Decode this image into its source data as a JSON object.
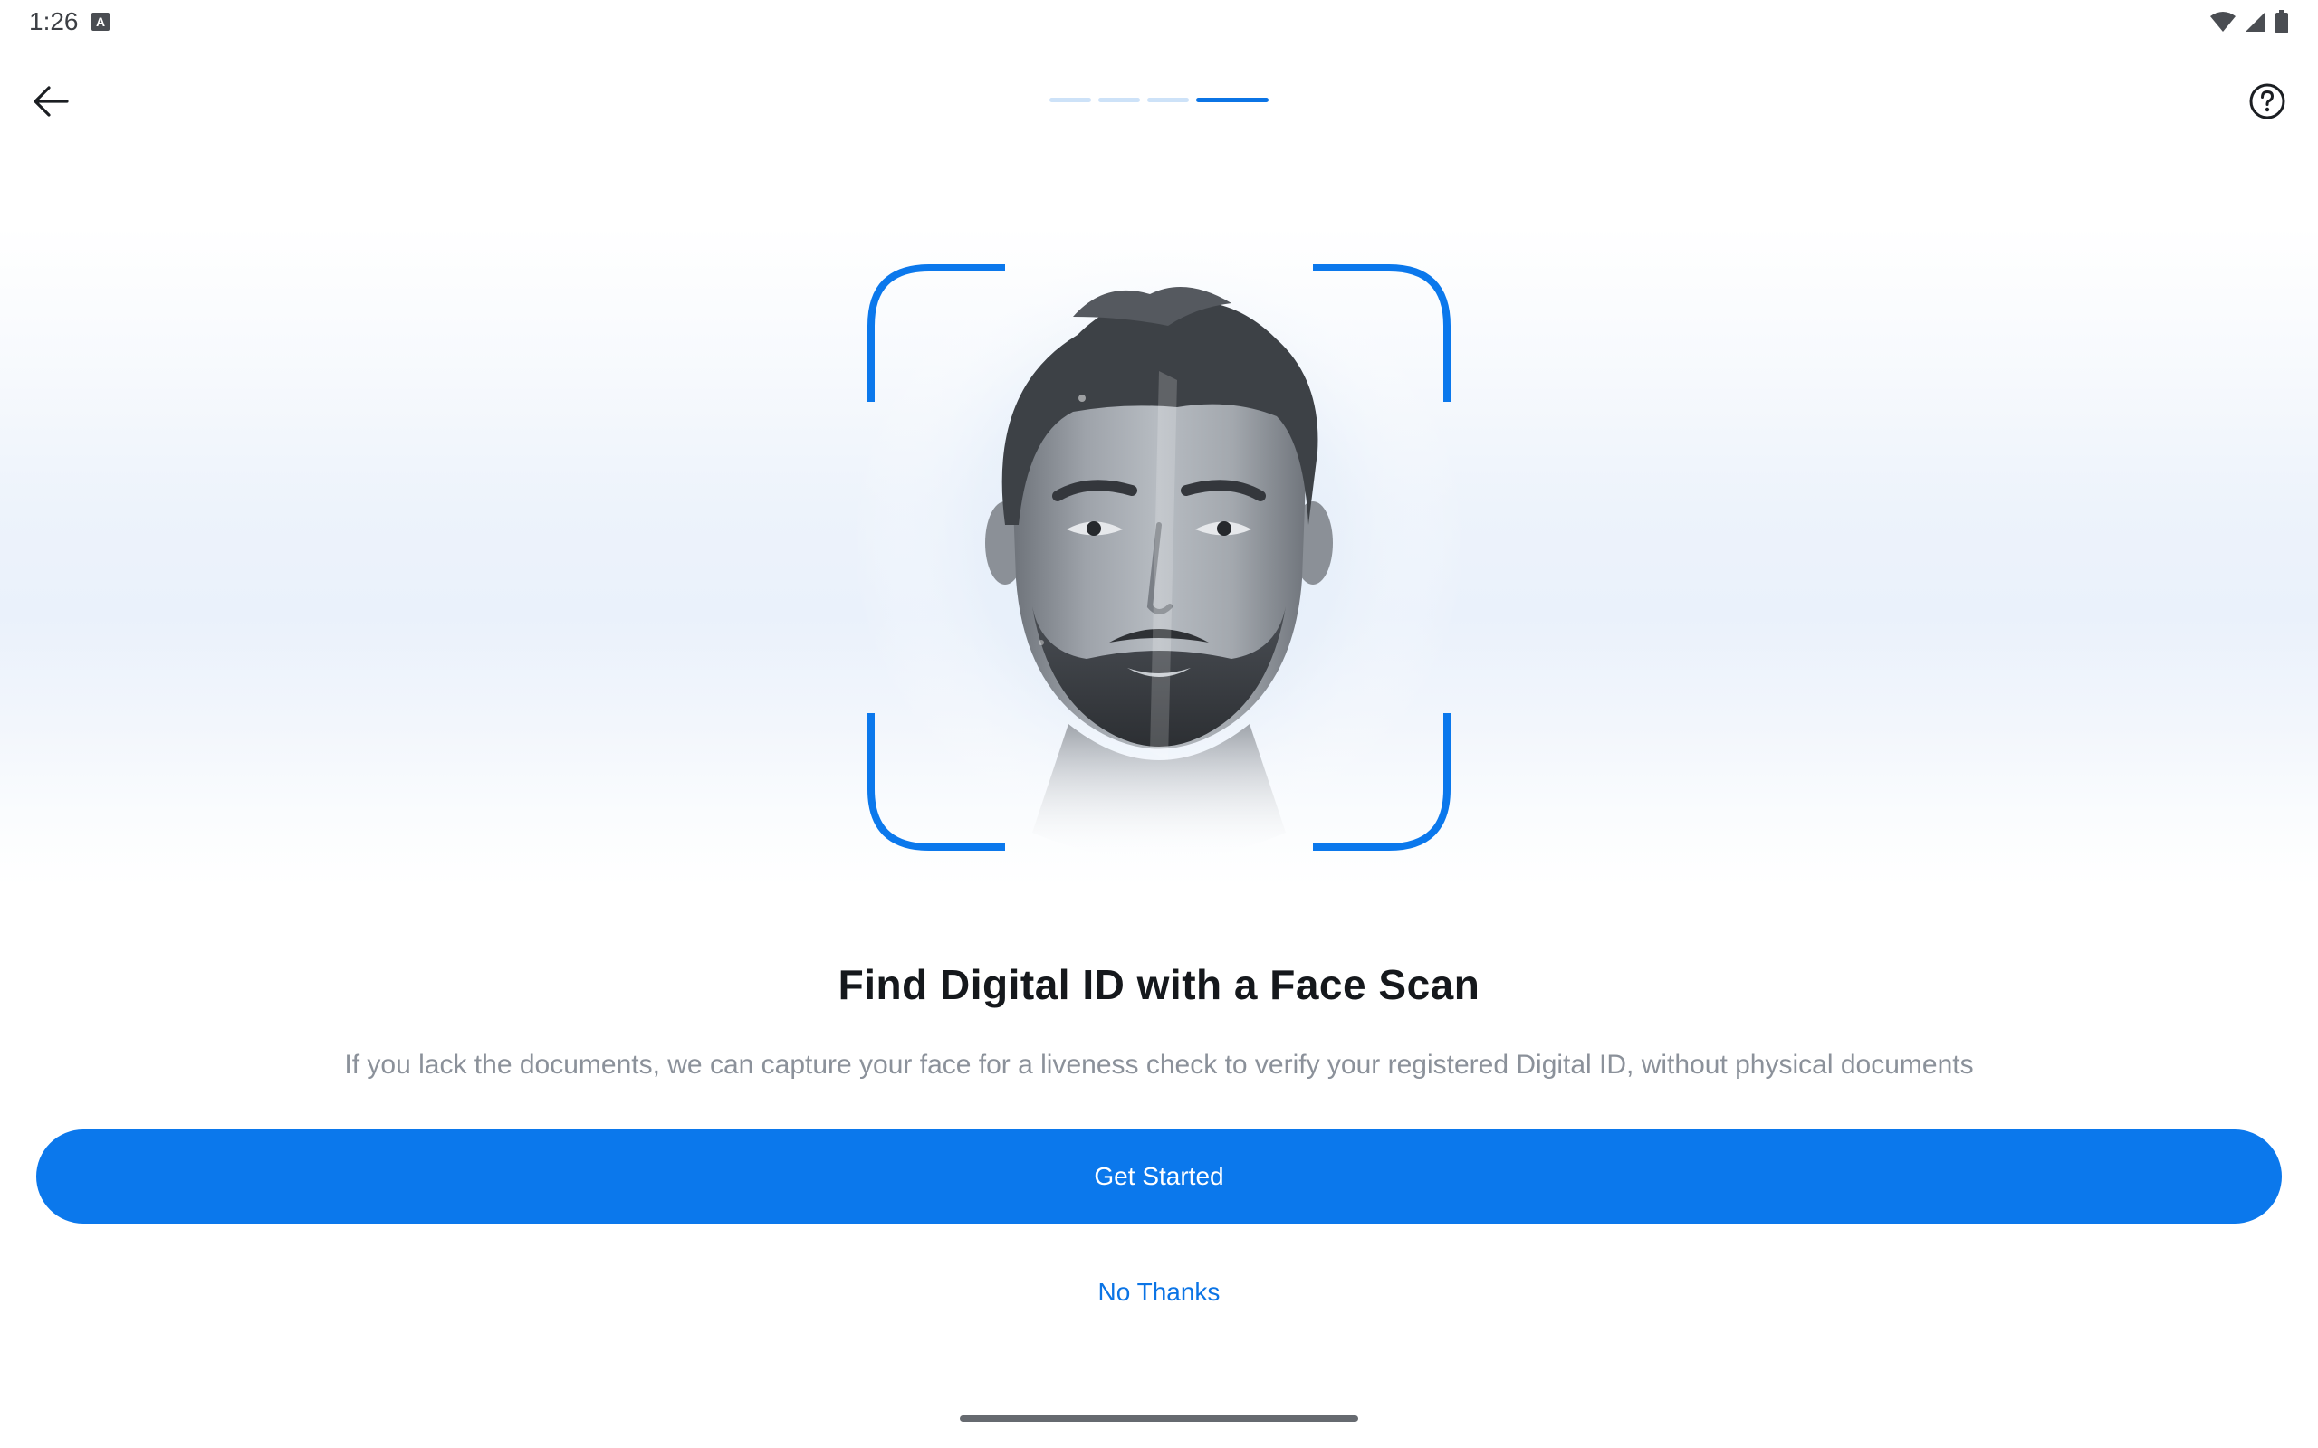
{
  "status_bar": {
    "time": "1:26",
    "notification_icon": "a-badge-icon",
    "icons": [
      "wifi-icon",
      "signal-icon",
      "battery-icon"
    ]
  },
  "app_bar": {
    "back_icon": "arrow-left-icon",
    "help_icon": "help-circle-icon"
  },
  "progress": {
    "total_steps": 4,
    "current_step": 4
  },
  "illustration": {
    "frame_icon": "face-scan-frame-icon",
    "image": "face-portrait"
  },
  "content": {
    "title": "Find Digital ID with a Face Scan",
    "description": "If you lack the documents, we can capture your face for a liveness check to verify your registered Digital ID, without physical documents"
  },
  "actions": {
    "primary_label": "Get Started",
    "secondary_label": "No Thanks"
  },
  "colors": {
    "accent": "#0B78EC",
    "progress_inactive": "#CDE2F8",
    "description_text": "#8B919A"
  }
}
